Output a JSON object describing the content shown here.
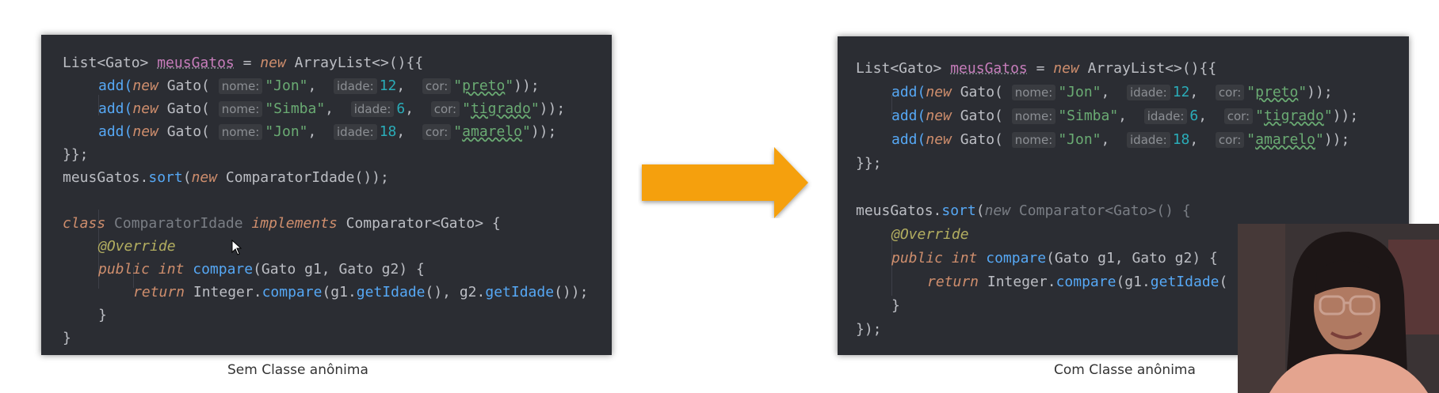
{
  "left": {
    "caption": "Sem Classe anônima",
    "lines": {
      "l1_a": "List<Gato> ",
      "l1_b": "meusGatos",
      "l1_c": " = ",
      "l1_d": "new",
      "l1_e": " ArrayList<>(){{",
      "l2_a": "add(",
      "l2_b": "new",
      "l2_c": " Gato( ",
      "l2_h1": "nome:",
      "l2_s1": "\"Jon\"",
      "l2_c2": ",  ",
      "l2_h2": "idade:",
      "l2_n": "12",
      "l2_c3": ",  ",
      "l2_h3": "cor:",
      "l2_q1": "\"",
      "l2_s2": "preto",
      "l2_q2": "\"",
      "l2_e": "));",
      "l3_a": "add(",
      "l3_b": "new",
      "l3_c": " Gato( ",
      "l3_h1": "nome:",
      "l3_s1": "\"Simba\"",
      "l3_c2": ",  ",
      "l3_h2": "idade:",
      "l3_n": "6",
      "l3_c3": ",  ",
      "l3_h3": "cor:",
      "l3_q1": "\"",
      "l3_s2": "tigrado",
      "l3_q2": "\"",
      "l3_e": "));",
      "l4_a": "add(",
      "l4_b": "new",
      "l4_c": " Gato( ",
      "l4_h1": "nome:",
      "l4_s1": "\"Jon\"",
      "l4_c2": ",  ",
      "l4_h2": "idade:",
      "l4_n": "18",
      "l4_c3": ",  ",
      "l4_h3": "cor:",
      "l4_q1": "\"",
      "l4_s2": "amarelo",
      "l4_q2": "\"",
      "l4_e": "));",
      "l5": "}};",
      "l6_a": "meusGatos.",
      "l6_b": "sort",
      "l6_c": "(",
      "l6_d": "new",
      "l6_e": " ComparatorIdade());",
      "l8_a": "class",
      "l8_b": " ComparatorIdade",
      "l8_c": "Idade",
      "l8_d": " ",
      "l8_e": "implements",
      "l8_f": " Comparator<Gato> {",
      "l9": "@Override",
      "l10_a": "public",
      "l10_b": " ",
      "l10_c": "int",
      "l10_d": " ",
      "l10_e": "compare",
      "l10_f": "(Gato g1, Gato g2) {",
      "l11_a": "return",
      "l11_b": " Integer.",
      "l11_c": "compare",
      "l11_d": "(g1.",
      "l11_e": "getIdade",
      "l11_f": "(), g2.",
      "l11_g": "getIdade",
      "l11_h": "());",
      "l12": "}",
      "l13": "}"
    }
  },
  "right": {
    "caption": "Com Classe anônima",
    "lines": {
      "l1_a": "List<Gato> ",
      "l1_b": "meusGatos",
      "l1_c": " = ",
      "l1_d": "new",
      "l1_e": " ArrayList<>(){{",
      "l2_a": "add(",
      "l2_b": "new",
      "l2_c": " Gato( ",
      "l2_h1": "nome:",
      "l2_s1": "\"Jon\"",
      "l2_c2": ",  ",
      "l2_h2": "idade:",
      "l2_n": "12",
      "l2_c3": ",  ",
      "l2_h3": "cor:",
      "l2_q1": "\"",
      "l2_s2": "preto",
      "l2_q2": "\"",
      "l2_e": "));",
      "l3_a": "add(",
      "l3_b": "new",
      "l3_c": " Gato( ",
      "l3_h1": "nome:",
      "l3_s1": "\"Simba\"",
      "l3_c2": ",  ",
      "l3_h2": "idade:",
      "l3_n": "6",
      "l3_c3": ",  ",
      "l3_h3": "cor:",
      "l3_q1": "\"",
      "l3_s2": "tigrado",
      "l3_q2": "\"",
      "l3_e": "));",
      "l4_a": "add(",
      "l4_b": "new",
      "l4_c": " Gato( ",
      "l4_h1": "nome:",
      "l4_s1": "\"Jon\"",
      "l4_c2": ",  ",
      "l4_h2": "idade:",
      "l4_n": "18",
      "l4_c3": ",  ",
      "l4_h3": "cor:",
      "l4_q1": "\"",
      "l4_s2": "amarelo",
      "l4_q2": "\"",
      "l4_e": "));",
      "l5": "}};",
      "l7_a": "meusGatos.",
      "l7_b": "sort",
      "l7_c": "(",
      "l7_d": "new",
      "l7_e": " Comparator<Gato>() {",
      "l8": "@Override",
      "l9_a": "public",
      "l9_b": " ",
      "l9_c": "int",
      "l9_d": " ",
      "l9_e": "compare",
      "l9_f": "(Gato g1, Gato g2) {",
      "l10_a": "return",
      "l10_b": " Integer.",
      "l10_c": "compare",
      "l10_d": "(g1.",
      "l10_e": "getIdade",
      "l10_f": "(",
      "l11": "}",
      "l12": "});"
    }
  },
  "colors": {
    "editor_bg": "#2b2d33",
    "keyword": "#cf8e6d",
    "method": "#56a8f5",
    "field": "#c77dbb",
    "string": "#6aab73",
    "number": "#2aacb8",
    "annotation": "#b3ae60",
    "arrow": "#f5a00c"
  },
  "icons": {
    "arrow": "right-arrow-icon",
    "cursor": "mouse-pointer-icon"
  }
}
